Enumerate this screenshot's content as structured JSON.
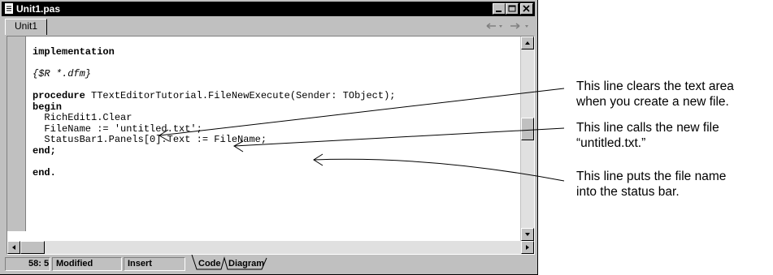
{
  "window": {
    "title": "Unit1.pas",
    "tab": "Unit1"
  },
  "code": {
    "lines": [
      {
        "text": "implementation",
        "style": "kw"
      },
      {
        "text": "",
        "style": ""
      },
      {
        "text": "{$R *.dfm}",
        "style": "cm"
      },
      {
        "text": "",
        "style": ""
      },
      {
        "kw": "procedure",
        "rest": " TTextEditorTutorial.FileNewExecute(Sender: TObject);"
      },
      {
        "text": "begin",
        "style": "kw"
      },
      {
        "text": "  RichEdit1.Clear",
        "style": ""
      },
      {
        "text": "  FileName := 'untitled.txt';",
        "style": ""
      },
      {
        "text": "  StatusBar1.Panels[0].Text := FileName;",
        "style": ""
      },
      {
        "text": "end;",
        "style": "kw"
      },
      {
        "text": "",
        "style": ""
      },
      {
        "text": "end.",
        "style": "kw"
      }
    ]
  },
  "status_bar": {
    "position": "58:  5",
    "modified": "Modified",
    "mode": "Insert",
    "tabs": [
      "Code",
      "Diagram"
    ]
  },
  "callouts": [
    {
      "text_1": "This line clears the text area",
      "text_2": "when you create a new file."
    },
    {
      "text_1": "This line calls the new file",
      "text_2": "“untitled.txt.”"
    },
    {
      "text_1": "This line puts the file name",
      "text_2": "into the status bar."
    }
  ]
}
